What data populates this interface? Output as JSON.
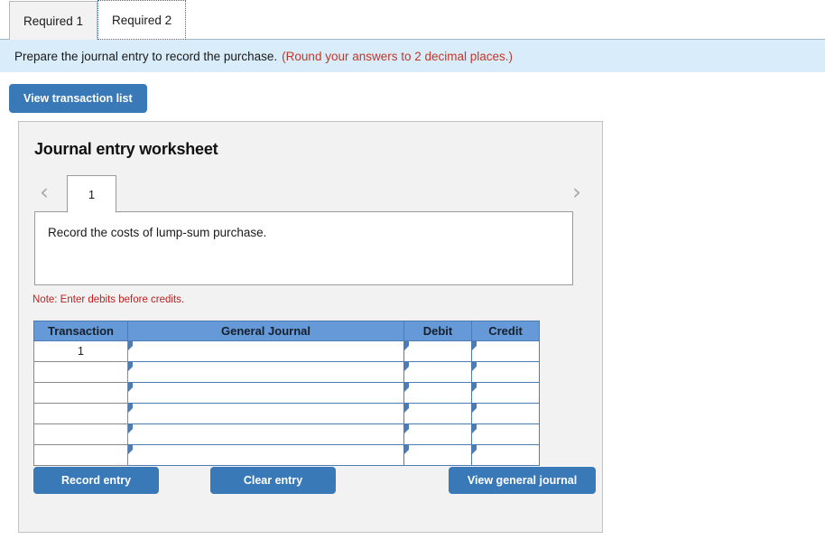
{
  "tabs": [
    {
      "label": "Required 1",
      "active": false
    },
    {
      "label": "Required 2",
      "active": true
    }
  ],
  "instruction": {
    "text": "Prepare the journal entry to record the purchase.",
    "hint": "(Round your answers to 2 decimal places.)",
    "hint_color": "#c0392b"
  },
  "toolbar": {
    "view_transaction_list_label": "View transaction list"
  },
  "worksheet": {
    "title": "Journal entry worksheet",
    "prev_icon": "chevron-left-icon",
    "next_icon": "chevron-right-icon",
    "prev_glyph": "‹",
    "next_glyph": "›",
    "page_tabs": [
      {
        "label": "1",
        "active": true
      }
    ],
    "description": "Record the costs of lump-sum purchase.",
    "note": "Note: Enter debits before credits.",
    "note_color": "#bb2222",
    "table": {
      "headers": [
        "Transaction",
        "General Journal",
        "Debit",
        "Credit"
      ],
      "rows": [
        {
          "transaction": "1",
          "general_journal": "",
          "debit": "",
          "credit": ""
        },
        {
          "transaction": "",
          "general_journal": "",
          "debit": "",
          "credit": ""
        },
        {
          "transaction": "",
          "general_journal": "",
          "debit": "",
          "credit": ""
        },
        {
          "transaction": "",
          "general_journal": "",
          "debit": "",
          "credit": ""
        },
        {
          "transaction": "",
          "general_journal": "",
          "debit": "",
          "credit": ""
        },
        {
          "transaction": "",
          "general_journal": "",
          "debit": "",
          "credit": ""
        }
      ]
    },
    "buttons": {
      "record_entry": "Record entry",
      "clear_entry": "Clear entry",
      "view_general_journal": "View general journal"
    }
  },
  "colors": {
    "button_blue": "#3a79b8",
    "table_header_blue": "#6699d8",
    "instruction_bar": "#d9ecf9",
    "panel_bg": "#f2f2f2"
  }
}
